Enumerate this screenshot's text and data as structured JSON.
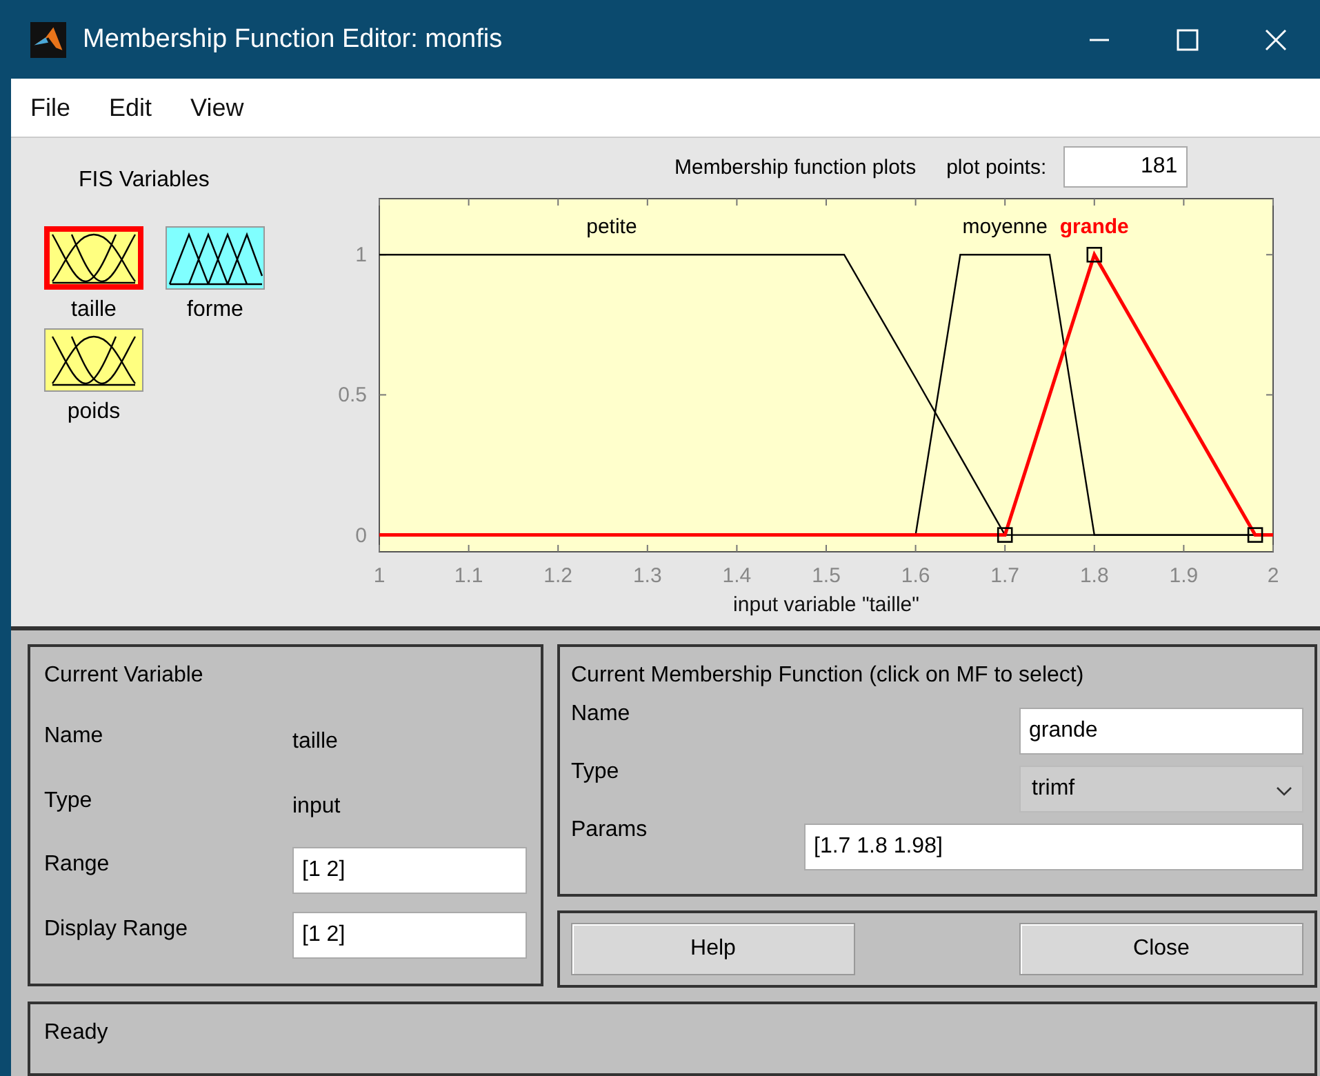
{
  "window": {
    "title": "Membership Function Editor: monfis"
  },
  "menu": [
    "File",
    "Edit",
    "View"
  ],
  "fis_variables": {
    "title": "FIS Variables",
    "items": [
      {
        "name": "taille",
        "kind": "input",
        "selected": true
      },
      {
        "name": "forme",
        "kind": "output",
        "selected": false
      },
      {
        "name": "poids",
        "kind": "input",
        "selected": false
      }
    ]
  },
  "plot": {
    "title": "Membership function plots",
    "plot_points_label": "plot points:",
    "plot_points": "181",
    "chart_data": {
      "type": "line",
      "xlabel": "input variable \"taille\"",
      "x": [
        1,
        1.52,
        1.6,
        1.65,
        1.7,
        1.75,
        1.8,
        1.98,
        2
      ],
      "series": [
        {
          "name": "petite",
          "color": "#000000",
          "values": [
            1,
            1,
            0.56,
            0.28,
            0,
            0,
            0,
            0,
            0
          ]
        },
        {
          "name": "moyenne",
          "color": "#000000",
          "values": [
            0,
            0,
            0,
            1,
            1,
            1,
            0,
            0,
            0
          ]
        },
        {
          "name": "grande",
          "color": "#ff0000",
          "values": [
            0,
            0,
            0,
            0,
            0,
            0.5,
            1,
            0,
            0
          ]
        }
      ],
      "xlim": [
        1,
        2
      ],
      "ylim": [
        -0.06,
        1.2
      ],
      "xticks": [
        {
          "value": 1,
          "label": "1"
        },
        {
          "value": 1.1,
          "label": "1.1"
        },
        {
          "value": 1.2,
          "label": "1.2"
        },
        {
          "value": 1.3,
          "label": "1.3"
        },
        {
          "value": 1.4,
          "label": "1.4"
        },
        {
          "value": 1.5,
          "label": "1.5"
        },
        {
          "value": 1.6,
          "label": "1.6"
        },
        {
          "value": 1.7,
          "label": "1.7"
        },
        {
          "value": 1.8,
          "label": "1.8"
        },
        {
          "value": 1.9,
          "label": "1.9"
        },
        {
          "value": 2,
          "label": "2"
        }
      ],
      "yticks": [
        {
          "value": 0,
          "label": "0"
        },
        {
          "value": 0.5,
          "label": "0.5"
        },
        {
          "value": 1,
          "label": "1"
        }
      ]
    }
  },
  "current_variable": {
    "title": "Current Variable",
    "name_label": "Name",
    "name": "taille",
    "type_label": "Type",
    "type": "input",
    "range_label": "Range",
    "range": "[1 2]",
    "display_range_label": "Display Range",
    "display_range": "[1 2]"
  },
  "current_mf": {
    "title": "Current Membership Function (click on MF to select)",
    "name_label": "Name",
    "name": "grande",
    "type_label": "Type",
    "type": "trimf",
    "params_label": "Params",
    "params": "[1.7 1.8 1.98]"
  },
  "buttons": [
    "Help",
    "Close"
  ],
  "status_bar": "Ready"
}
